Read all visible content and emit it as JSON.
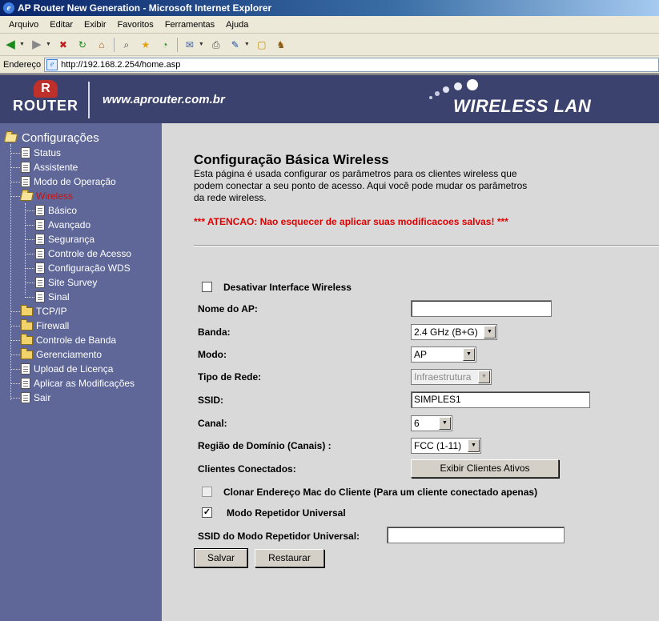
{
  "window": {
    "title": "AP Router New Generation - Microsoft Internet Explorer",
    "menu": [
      "Arquivo",
      "Editar",
      "Exibir",
      "Favoritos",
      "Ferramentas",
      "Ajuda"
    ],
    "address_label": "Endereço",
    "url": "http://192.168.2.254/home.asp"
  },
  "banner": {
    "logo_text": "ROUTER",
    "site_url": "www.aprouter.com.br",
    "product_text": "WIRELESS LAN"
  },
  "sidebar": {
    "root": "Configurações",
    "items": [
      {
        "label": "Status",
        "icon": "doc-icon"
      },
      {
        "label": "Assistente",
        "icon": "doc-icon"
      },
      {
        "label": "Modo de Operação",
        "icon": "doc-icon"
      },
      {
        "label": "Wireless",
        "icon": "folder-open-icon",
        "active": true
      },
      {
        "label": "Básico",
        "icon": "doc-icon"
      },
      {
        "label": "Avançado",
        "icon": "doc-icon"
      },
      {
        "label": "Segurança",
        "icon": "doc-icon"
      },
      {
        "label": "Controle de Acesso",
        "icon": "doc-icon"
      },
      {
        "label": "Configuração WDS",
        "icon": "doc-icon"
      },
      {
        "label": "Site Survey",
        "icon": "doc-icon"
      },
      {
        "label": "Sinal",
        "icon": "doc-icon"
      },
      {
        "label": "TCP/IP",
        "icon": "folder-icon"
      },
      {
        "label": "Firewall",
        "icon": "folder-icon"
      },
      {
        "label": "Controle de Banda",
        "icon": "folder-icon"
      },
      {
        "label": "Gerenciamento",
        "icon": "folder-icon"
      },
      {
        "label": "Upload de Licença",
        "icon": "doc-icon"
      },
      {
        "label": "Aplicar as Modificações",
        "icon": "doc-icon"
      },
      {
        "label": "Sair",
        "icon": "doc-icon"
      }
    ]
  },
  "page": {
    "title": "Configuração Básica Wireless",
    "description": "Esta página é usada configurar os parâmetros para os clientes wireless que podem conectar a seu ponto de acesso. Aqui você pode mudar os parâmetros da rede wireless.",
    "warning": "*** ATENCAO: Nao esquecer de aplicar suas modificacoes salvas! ***"
  },
  "form": {
    "disable_wireless": {
      "label": "Desativar Interface Wireless",
      "checked": false
    },
    "ap_name": {
      "label": "Nome do AP:",
      "value": ""
    },
    "band": {
      "label": "Banda:",
      "value": "2.4 GHz (B+G)"
    },
    "mode": {
      "label": "Modo:",
      "value": "AP"
    },
    "network_type": {
      "label": "Tipo de Rede:",
      "value": "Infraestrutura",
      "disabled": true
    },
    "ssid": {
      "label": "SSID:",
      "value": "SIMPLES1"
    },
    "channel": {
      "label": "Canal:",
      "value": "6"
    },
    "domain_region": {
      "label": "Região de Domínio (Canais) :",
      "value": "FCC (1-11)"
    },
    "connected_clients": {
      "label": "Clientes Conectados:",
      "button": "Exibir Clientes Ativos"
    },
    "clone_mac": {
      "label": "Clonar Endereço Mac do Cliente (Para um cliente conectado apenas)",
      "checked": false
    },
    "universal_repeater": {
      "label": "Modo Repetidor Universal",
      "checked": true
    },
    "repeater_ssid": {
      "label": "SSID do Modo Repetidor Universal:",
      "value": ""
    },
    "save_button": "Salvar",
    "reset_button": "Restaurar"
  },
  "colors": {
    "sidebar_bg": "#5e6797",
    "banner_bg": "#3b426d",
    "content_bg": "#d9d9d9",
    "warning": "#e00000",
    "active_menu": "#d01010"
  }
}
